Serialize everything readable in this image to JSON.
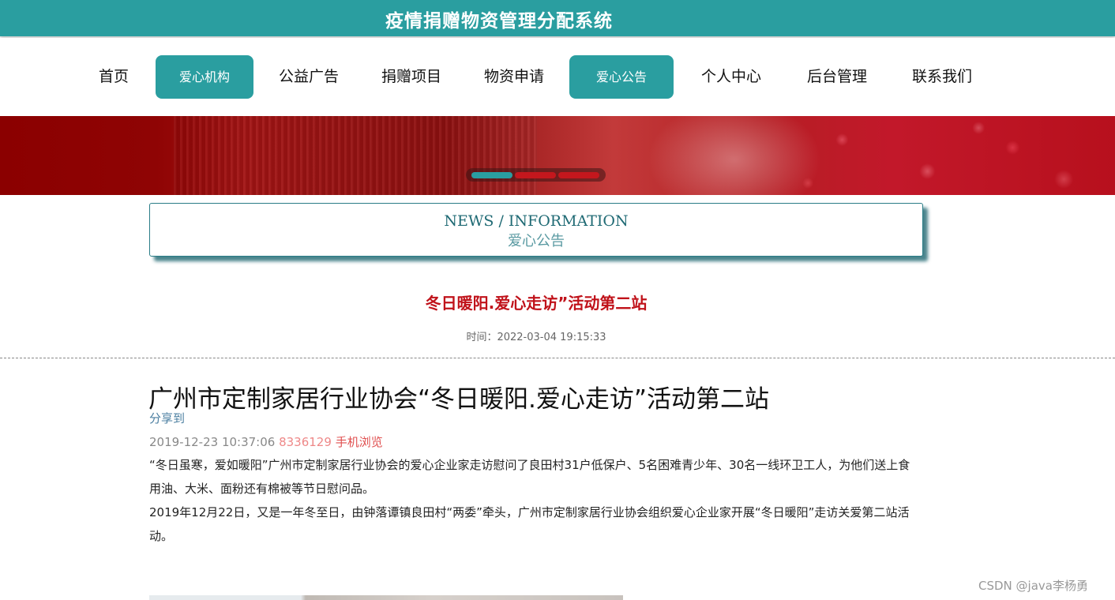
{
  "header": {
    "title": "疫情捐赠物资管理分配系统"
  },
  "nav": {
    "items": [
      {
        "label": "首页"
      },
      {
        "label": "爱心机构"
      },
      {
        "label": "公益广告"
      },
      {
        "label": "捐赠项目"
      },
      {
        "label": "物资申请"
      },
      {
        "label": "爱心公告"
      },
      {
        "label": "个人中心"
      },
      {
        "label": "后台管理"
      },
      {
        "label": "联系我们"
      }
    ],
    "active_items": [
      "爱心机构",
      "爱心公告"
    ]
  },
  "colors": {
    "accent": "#2a9ea0",
    "headline": "#c0121a",
    "banner": "#8b0000"
  },
  "section_box": {
    "english": "NEWS / INFORMATION",
    "chinese": "爱心公告"
  },
  "notice": {
    "title": "冬日暖阳.爱心走访”活动第二站",
    "time_label": "时间：",
    "time_value": "2022-03-04 19:15:33"
  },
  "article": {
    "title": "广州市定制家居行业协会“冬日暖阳.爱心走访”活动第二站",
    "share_label": "分享到",
    "date": "2019-12-23 10:37:06",
    "views": "8336129",
    "mobile_label": "手机浏览",
    "paragraphs": [
      "“冬日虽寒，爱如暖阳”广州市定制家居行业协会的爱心企业家走访慰问了良田村31户低保户、5名困难青少年、30名一线环卫工人，为他们送上食用油、大米、面粉还有棉被等节日慰问品。",
      "2019年12月22日，又是一年冬至日，由钟落谭镇良田村“两委”牵头，广州市定制家居行业协会组织爱心企业家开展“冬日暖阳”走访关爱第二站活动。"
    ]
  },
  "watermark": "CSDN @java李杨勇"
}
